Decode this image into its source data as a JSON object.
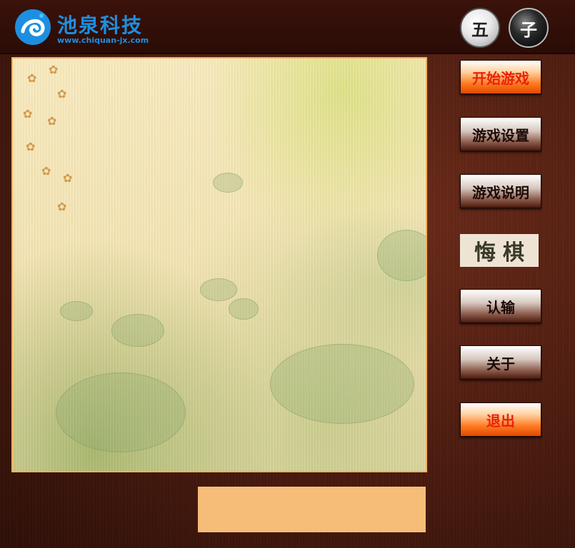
{
  "header": {
    "logo_title": "池泉科技",
    "logo_url": "www.chiquan-jx.com",
    "piece_white_label": "五",
    "piece_black_label": "子"
  },
  "menu": {
    "start_game": "开始游戏",
    "game_settings": "游戏设置",
    "game_instructions": "游戏说明",
    "undo_move": "悔棋",
    "resign": "认输",
    "about": "关于",
    "exit": "退出"
  },
  "status": {
    "text": ""
  },
  "colors": {
    "brand_blue": "#1e8fe0",
    "hot_button_text": "#e8220a",
    "board_border": "#f0b060",
    "status_box": "#f5bd78",
    "wood_dark": "#4a1a0e"
  },
  "icons": {
    "logo": "chiquan-logo-icon",
    "white_piece": "white-stone-icon",
    "black_piece": "black-stone-icon"
  }
}
